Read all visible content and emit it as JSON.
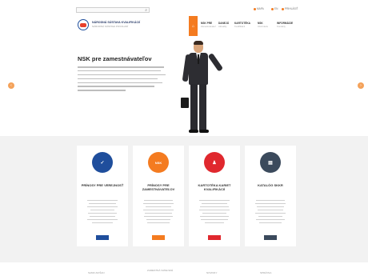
{
  "topbar": {
    "search_icon": "search-icon",
    "links": [
      "MAPA",
      "EN",
      "PRIHLÁSIŤ"
    ]
  },
  "header": {
    "org_name": "NÁRODNÁ SÚSTAVA KVALIFIKÁCIÍ",
    "org_sub": "NÁRODNÁ SÚSTAVA POVOLANÍ",
    "nav": [
      {
        "label": "NSK PRE",
        "sub": "Zamestnávateľ"
      },
      {
        "label": "DANEJÚ",
        "sub": "Aktuality"
      },
      {
        "label": "KARTOTÉKA",
        "sub": "Kvalifikácií"
      },
      {
        "label": "NSK",
        "sub": "Informácie"
      },
      {
        "label": "INFORMÁCIE",
        "sub": "Kontakty"
      }
    ]
  },
  "hero": {
    "title": "NSK pre zamestnávateľov"
  },
  "cards": [
    {
      "title": "PRÍNOSY PRE VEREJNOSŤ",
      "icon": "check-icon",
      "icon_glyph": "✓",
      "color": "#1f4e9c",
      "btn_color": "#1f4e9c",
      "btn_label": ""
    },
    {
      "title": "PRÍNOSY PRE ZAMESTNÁVATEĽOV",
      "icon": "nsk-badge-icon",
      "icon_glyph": "NSK",
      "color": "#f47b20",
      "btn_color": "#f47b20",
      "btn_label": ""
    },
    {
      "title": "KARTOTÉKA KARIET KVALIFIKÁCIÍ",
      "icon": "user-badge-icon",
      "icon_glyph": "♟",
      "color": "#e0282e",
      "btn_color": "#e0282e",
      "btn_label": ""
    },
    {
      "title": "KATALÓG SKKR",
      "icon": "catalog-icon",
      "icon_glyph": "▤",
      "color": "#3b4a5c",
      "btn_color": "#3b4a5c",
      "btn_label": ""
    }
  ],
  "bottom": [
    "SAMO AKIŠAN",
    "ZAMESTNÁ VATEĽSKÉ",
    "NOVINKY",
    "SPRÁVNA"
  ],
  "colors": {
    "accent": "#f47b20",
    "primary": "#1f4e9c"
  }
}
